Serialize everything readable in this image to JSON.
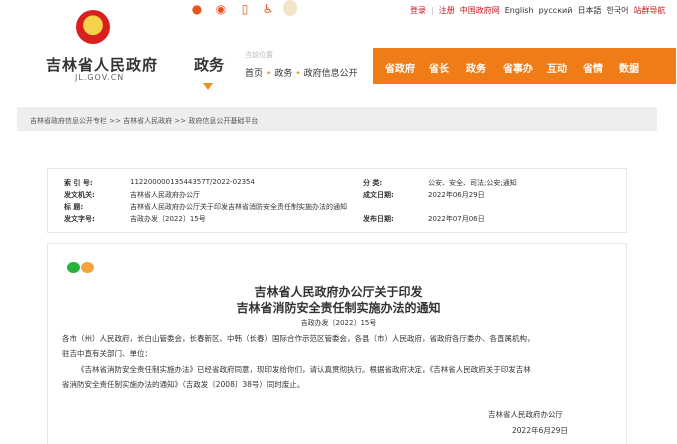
{
  "topbar": {
    "links": {
      "login": "登录",
      "separator": "|",
      "register": "注册",
      "china_gov": "中国政府网",
      "english": "English",
      "russian": "русский",
      "japanese": "日本語",
      "korean": "한국어",
      "site_nav": "站群导航"
    }
  },
  "header": {
    "site_title": "吉林省人民政府",
    "site_url": "JL.GOV.CN",
    "section_title": "政务",
    "location_label": "当前位置",
    "breadcrumb": [
      "首页",
      "政务",
      "政府信息公开"
    ]
  },
  "main_nav": [
    "省政府",
    "省长",
    "政务",
    "省事办",
    "互动",
    "省情",
    "数据"
  ],
  "path_breadcrumb": "吉林省政府信息公开专栏 >> 吉林省人民政府 >> 政府信息公开基础平台",
  "info": {
    "index_label": "索 引 号:",
    "index_value": "11220000013544357T/2022-02354",
    "category_label": "分 类:",
    "category_value": "公安、安全、司法;公安;通知",
    "issuer_label": "发文机关:",
    "issuer_value": "吉林省人民政府办公厅",
    "written_label": "成文日期:",
    "written_value": "2022年06月29日",
    "title_label": "标 题:",
    "title_value": "吉林省人民政府办公厅关于印发吉林省消防安全责任制实施办法的通知",
    "docno_label": "发文字号:",
    "docno_value": "吉政办发〔2022〕15号",
    "pubdate_label": "发布日期:",
    "pubdate_value": "2022年07月06日"
  },
  "article": {
    "title_line1": "吉林省人民政府办公厅关于印发",
    "title_line2": "吉林省消防安全责任制实施办法的通知",
    "doc_number": "吉政办发〔2022〕15号",
    "para1_line1": "各市（州）人民政府，长白山管委会，长春新区、中韩（长春）国际合作示范区管委会，各县（市）人民政府，省政府各厅委办、各直属机构，",
    "para1_line2": "驻吉中直有关部门、单位：",
    "para2_line1": "《吉林省消防安全责任制实施办法》已经省政府同意，现印发给你们，请认真贯彻执行。根据省政府决定，《吉林省人民政府关于印发吉林",
    "para2_line2": "省消防安全责任制实施办法的通知》（吉政发〔2008〕38号）同时废止。",
    "signature_org": "吉林省人民政府办公厅",
    "signature_date": "2022年6月29日"
  },
  "colors": {
    "accent_orange": "#f07c17",
    "link_red": "#c8161e",
    "band_grey": "#eeeeee"
  },
  "icons": [
    "weibo-icon",
    "wechat-icon",
    "mobile-icon",
    "accessibility-icon",
    "elder-mode-icon",
    "wechat-share-icon",
    "weibo-share-icon"
  ]
}
